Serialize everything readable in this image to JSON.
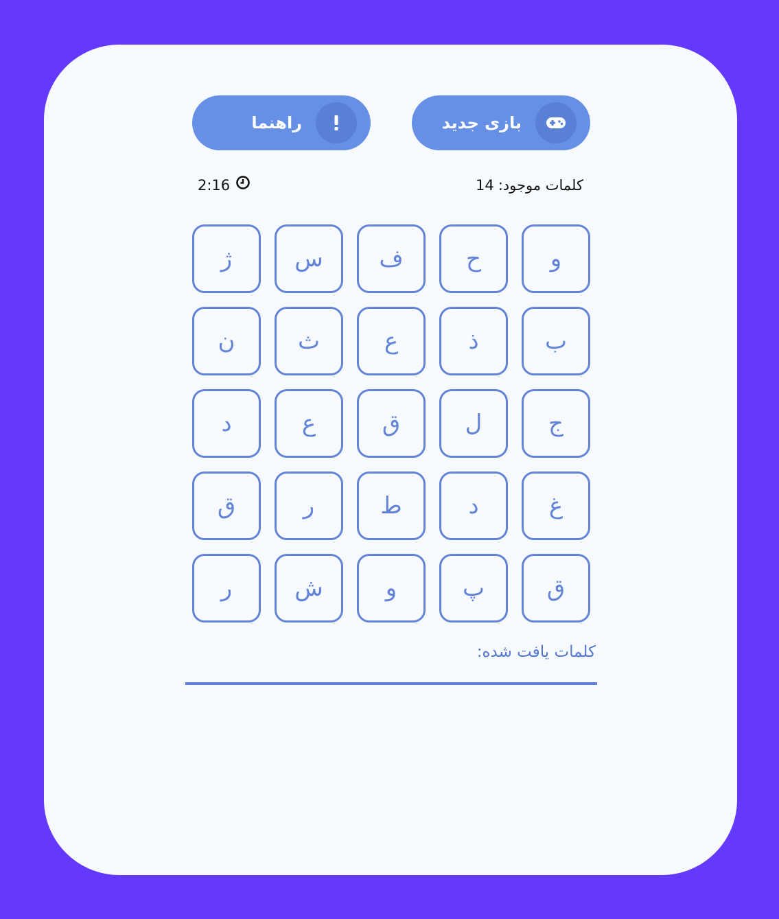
{
  "toolbar": {
    "new_game_label": "بازی جدید",
    "new_game_icon": "gamepad-icon",
    "help_label": "راهنما",
    "help_icon": "exclamation-icon"
  },
  "status": {
    "words_available_label": "کلمات موجود:",
    "words_available_count": "14",
    "timer_value": "2:16",
    "timer_icon": "clock-icon"
  },
  "grid": {
    "rows": [
      [
        "و",
        "ح",
        "ف",
        "س",
        "ژ"
      ],
      [
        "ب",
        "ذ",
        "ع",
        "ث",
        "ن"
      ],
      [
        "ج",
        "ل",
        "ق",
        "ع",
        "د"
      ],
      [
        "غ",
        "د",
        "ط",
        "ر",
        "ق"
      ],
      [
        "ق",
        "پ",
        "و",
        "ش",
        "ر"
      ]
    ]
  },
  "found": {
    "label": "کلمات یافت شده:",
    "words": []
  },
  "colors": {
    "background": "#6438fd",
    "card": "#f6fafd",
    "accent": "#6283d6",
    "button": "#6590e5"
  }
}
